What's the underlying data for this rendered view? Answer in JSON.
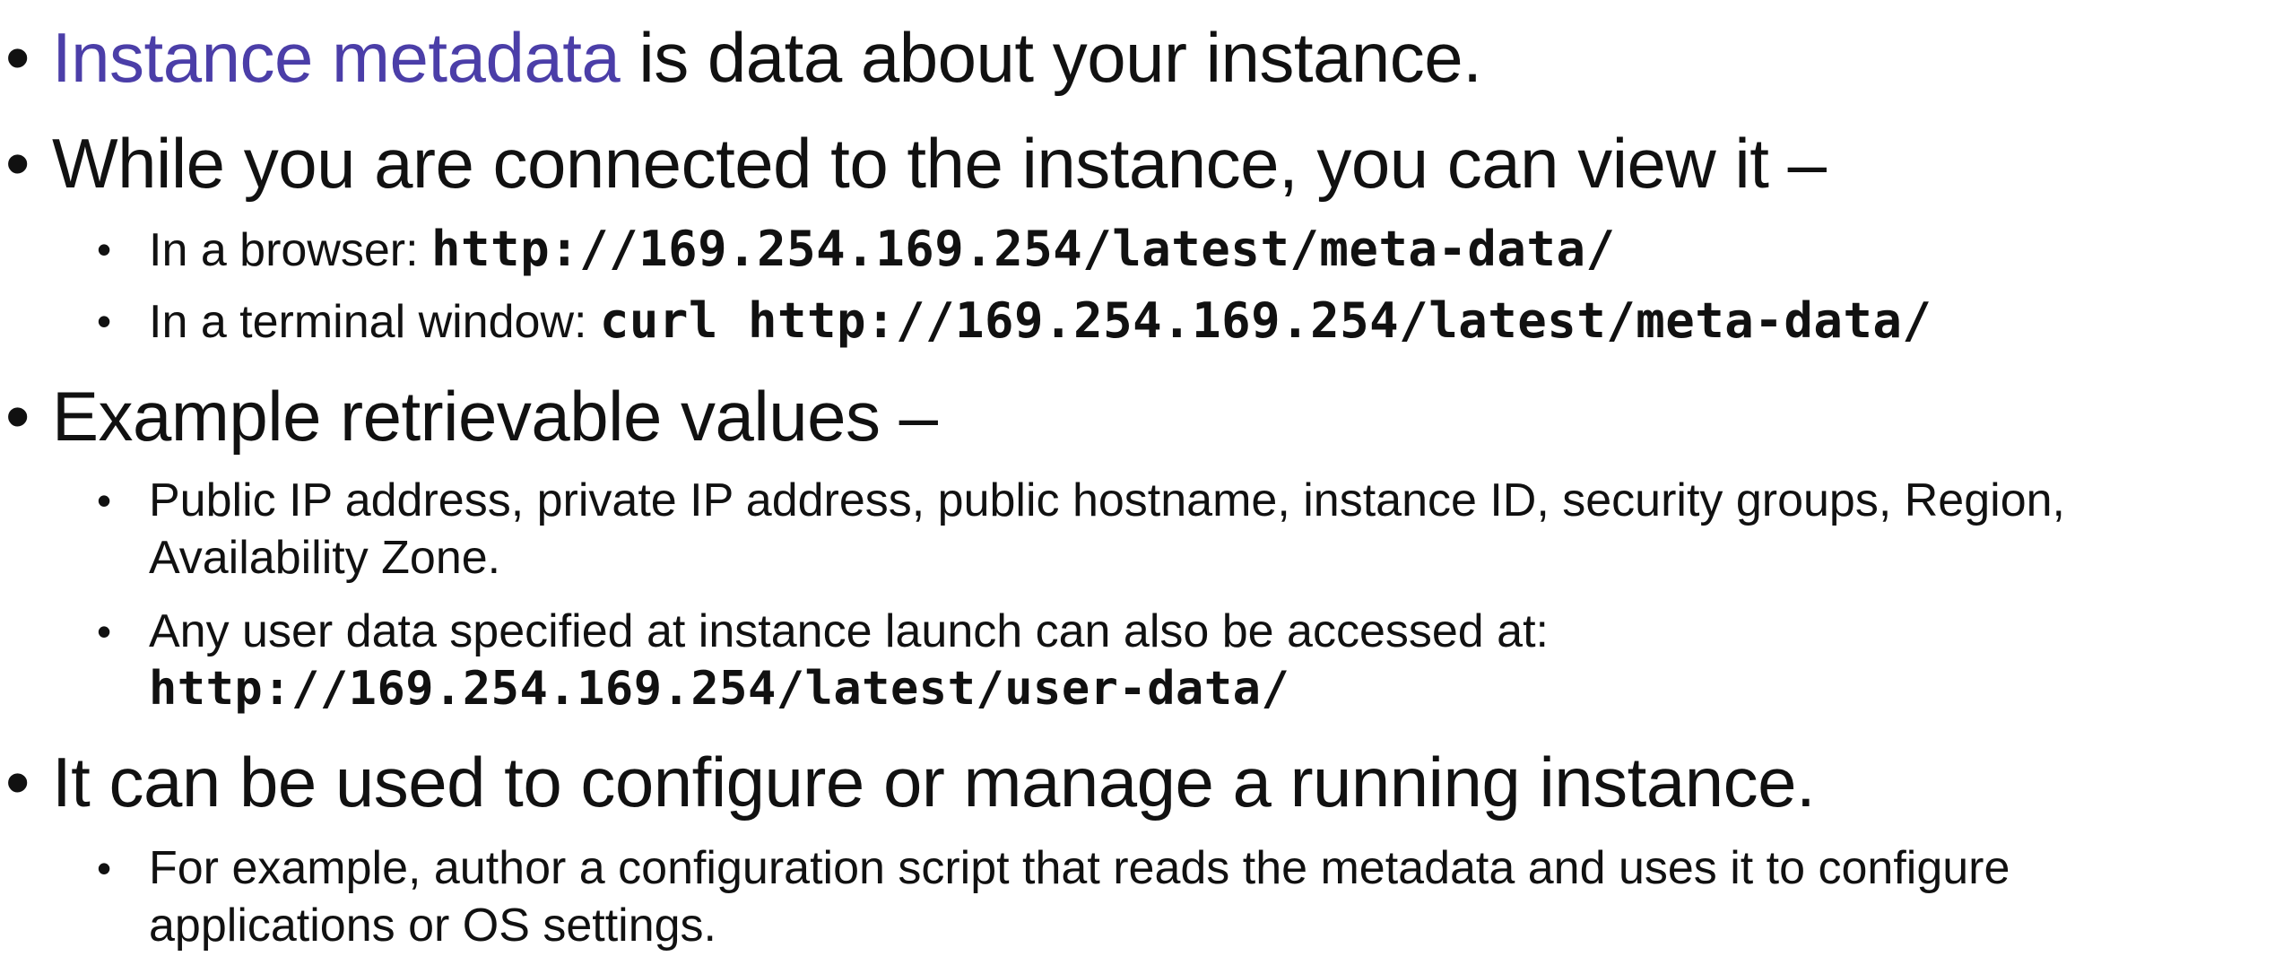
{
  "colors": {
    "highlight": "#4b3ea8",
    "text": "#111111",
    "background": "#ffffff"
  },
  "bullets": {
    "b1": {
      "highlight": "Instance metadata",
      "rest": " is data about your instance."
    },
    "b2": {
      "text": "While you are connected to the instance, you can view it –",
      "sub1": {
        "label": "In a browser: ",
        "code": "http://169.254.169.254/latest/meta-data/"
      },
      "sub2": {
        "label": "In a terminal window: ",
        "code": "curl http://169.254.169.254/latest/meta-data/"
      }
    },
    "b3": {
      "text": "Example retrievable values –",
      "sub1": {
        "line1": "Public IP address, private IP address, public hostname, instance ID, security groups, Region,",
        "line2": "Availability Zone."
      },
      "sub2": {
        "line1": "Any user data specified at instance launch can also be accessed at:",
        "code": "http://169.254.169.254/latest/user-data/"
      }
    },
    "b4": {
      "text": "It can be used to configure or manage a running instance.",
      "sub1": {
        "line1": "For example, author a configuration script that reads the metadata and uses it to configure",
        "line2": "applications or OS settings."
      }
    }
  }
}
